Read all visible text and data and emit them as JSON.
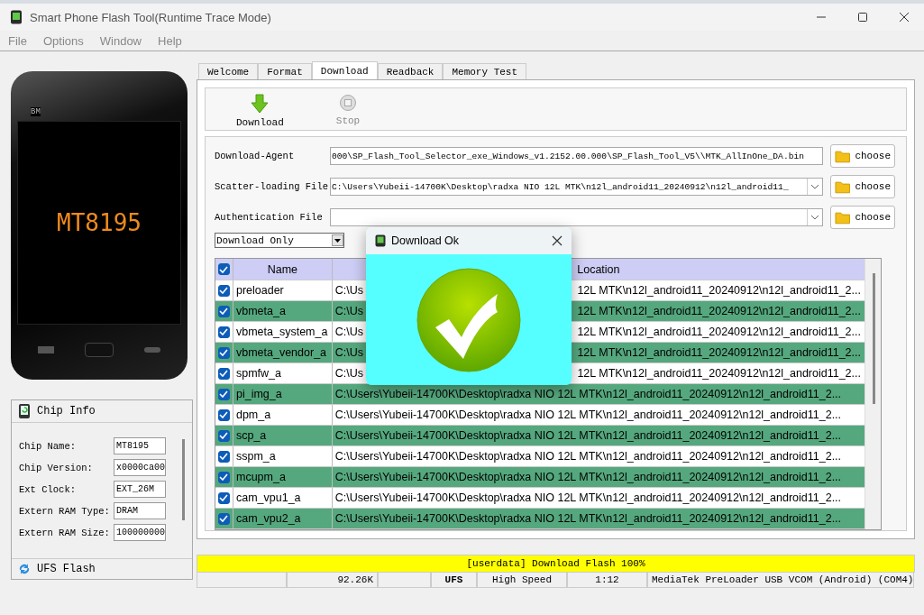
{
  "window": {
    "title": "Smart Phone Flash Tool(Runtime Trace Mode)"
  },
  "menu": [
    "File",
    "Options",
    "Window",
    "Help"
  ],
  "device": {
    "brand_mark": "BM",
    "screen_label": "MT8195"
  },
  "chip_info": {
    "title": "Chip Info",
    "fields": [
      {
        "label": "Chip Name:",
        "value": "MT8195"
      },
      {
        "label": "Chip Version:",
        "value": "x0000ca00"
      },
      {
        "label": "Ext Clock:",
        "value": "EXT_26M"
      },
      {
        "label": "Extern RAM Type:",
        "value": "DRAM"
      },
      {
        "label": "Extern RAM Size:",
        "value": "100000000"
      }
    ]
  },
  "ufs_flash": {
    "title": "UFS Flash"
  },
  "tabs": [
    {
      "label": "Welcome",
      "selected": false
    },
    {
      "label": "Format",
      "selected": false
    },
    {
      "label": "Download",
      "selected": true
    },
    {
      "label": "Readback",
      "selected": false
    },
    {
      "label": "Memory Test",
      "selected": false
    }
  ],
  "toolbar": [
    {
      "label": "Download",
      "kind": "download",
      "disabled": false
    },
    {
      "label": "Stop",
      "kind": "stop",
      "disabled": true
    }
  ],
  "files": [
    {
      "label": "Download-Agent",
      "value": "000\\SP_Flash_Tool_Selector_exe_Windows_v1.2152.00.000\\SP_Flash_Tool_V5\\\\MTK_AllInOne_DA.bin",
      "dropdown": false,
      "button": "choose"
    },
    {
      "label": "Scatter-loading File",
      "value": "C:\\Users\\Yubeii-14700K\\Desktop\\radxa NIO 12L MTK\\n12l_android11_20240912\\n12l_android11_",
      "dropdown": true,
      "button": "choose"
    },
    {
      "label": "Authentication File",
      "dropdown": true,
      "button": "choose"
    }
  ],
  "mode_select": {
    "value": "Download Only"
  },
  "table": {
    "all_checked": true,
    "columns": [
      "Name",
      "Location"
    ],
    "rows": [
      {
        "name": "preloader",
        "checked": true,
        "location": [
          "C:\\Us",
          "12L MTK\\n12l_android11_20240912\\n12l_android11_2..."
        ]
      },
      {
        "name": "vbmeta_a",
        "checked": true,
        "location": [
          "C:\\Us",
          "12L MTK\\n12l_android11_20240912\\n12l_android11_2..."
        ]
      },
      {
        "name": "vbmeta_system_a",
        "checked": true,
        "location": [
          "C:\\Us",
          "12L MTK\\n12l_android11_20240912\\n12l_android11_2..."
        ]
      },
      {
        "name": "vbmeta_vendor_a",
        "checked": true,
        "location": [
          "C:\\Us",
          "12L MTK\\n12l_android11_20240912\\n12l_android11_2..."
        ]
      },
      {
        "name": "spmfw_a",
        "checked": true,
        "location": [
          "C:\\Us",
          "12L MTK\\n12l_android11_20240912\\n12l_android11_2..."
        ]
      },
      {
        "name": "pi_img_a",
        "checked": true,
        "location": [
          "C:\\Users\\Yubeii-14700K\\Desktop\\radxa NIO 12L MTK\\n12l_android11_20240912\\n12l_android11_2..."
        ]
      },
      {
        "name": "dpm_a",
        "checked": true,
        "location": [
          "C:\\Users\\Yubeii-14700K\\Desktop\\radxa NIO 12L MTK\\n12l_android11_20240912\\n12l_android11_2..."
        ]
      },
      {
        "name": "scp_a",
        "checked": true,
        "location": [
          "C:\\Users\\Yubeii-14700K\\Desktop\\radxa NIO 12L MTK\\n12l_android11_20240912\\n12l_android11_2..."
        ]
      },
      {
        "name": "sspm_a",
        "checked": true,
        "location": [
          "C:\\Users\\Yubeii-14700K\\Desktop\\radxa NIO 12L MTK\\n12l_android11_20240912\\n12l_android11_2..."
        ]
      },
      {
        "name": "mcupm_a",
        "checked": true,
        "location": [
          "C:\\Users\\Yubeii-14700K\\Desktop\\radxa NIO 12L MTK\\n12l_android11_20240912\\n12l_android11_2..."
        ]
      },
      {
        "name": "cam_vpu1_a",
        "checked": true,
        "location": [
          "C:\\Users\\Yubeii-14700K\\Desktop\\radxa NIO 12L MTK\\n12l_android11_20240912\\n12l_android11_2..."
        ]
      },
      {
        "name": "cam_vpu2_a",
        "checked": true,
        "location": [
          "C:\\Users\\Yubeii-14700K\\Desktop\\radxa NIO 12L MTK\\n12l_android11_20240912\\n12l_android11_2..."
        ]
      }
    ]
  },
  "dialog": {
    "title": "Download Ok"
  },
  "progress": {
    "text": "[userdata] Download Flash 100%",
    "level": 1
  },
  "status_bar": [
    {
      "kind": "blank"
    },
    {
      "kind": "text",
      "text": "92.26K"
    },
    {
      "kind": "blank"
    },
    {
      "kind": "text",
      "text": "UFS"
    },
    {
      "kind": "text",
      "text": "High Speed"
    },
    {
      "kind": "text",
      "text": "1:12"
    },
    {
      "kind": "text",
      "text": "MediaTek PreLoader USB VCOM (Android) (COM4)"
    }
  ]
}
